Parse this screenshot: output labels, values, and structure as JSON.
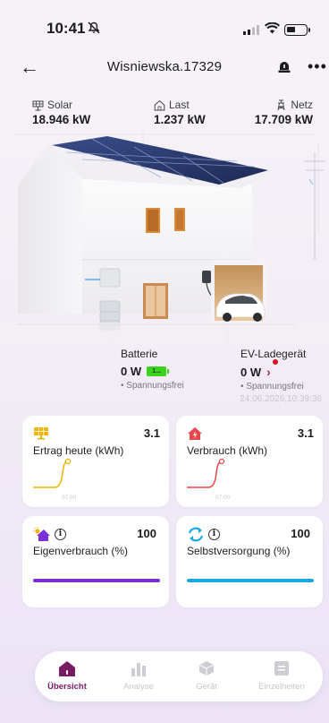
{
  "status_bar": {
    "time": "10:41"
  },
  "header": {
    "title": "Wisniewska.17329"
  },
  "flows": {
    "solar": {
      "label": "Solar",
      "value": "18.946 kW"
    },
    "last": {
      "label": "Last",
      "value": "1.237 kW"
    },
    "netz": {
      "label": "Netz",
      "value": "17.709 kW"
    }
  },
  "battery": {
    "label": "Batterie",
    "value": "0 W",
    "battery_badge": "1...",
    "state": "• Spannungsfrei"
  },
  "ev_charger": {
    "label": "EV-Ladegerät",
    "value": "0 W",
    "state": "• Spannungsfrei"
  },
  "timestamp": "24.06.2026,10:39:36",
  "cards": {
    "yield": {
      "title": "Ertrag heute (kWh)",
      "value": "3.1",
      "time_label": "07:00",
      "color": "#f0b400"
    },
    "consumption": {
      "title": "Verbrauch (kWh)",
      "value": "3.1",
      "time_label": "07:00",
      "color": "#e8474b"
    },
    "self_consumption": {
      "title": "Eigenverbrauch (%)",
      "value": "100",
      "progress_percent": 100,
      "color": "#7b2fd6"
    },
    "self_sufficiency": {
      "title": "Selbstversorgung (%)",
      "value": "100",
      "progress_percent": 100,
      "color": "#1aa9e8"
    }
  },
  "nav": {
    "items": [
      {
        "label": "Übersicht",
        "icon": "home-icon",
        "active": true
      },
      {
        "label": "Analyse",
        "icon": "bar-chart-icon",
        "active": false
      },
      {
        "label": "Gerät",
        "icon": "device-cube-icon",
        "active": false
      },
      {
        "label": "Einzelheiten",
        "icon": "details-icon",
        "active": false
      }
    ]
  },
  "colors": {
    "accent": "#7a1c64",
    "battery_green": "#3bd11e",
    "ev_arrow": "#c02a4a"
  }
}
